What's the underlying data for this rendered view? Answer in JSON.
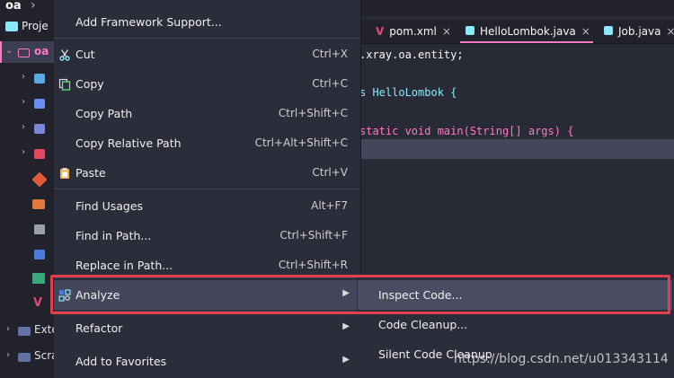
{
  "breadcrumb": {
    "label": "oa"
  },
  "project_panel": {
    "tab_label": "Proje",
    "root_label": "oa",
    "bottom_items": [
      {
        "label": "Exte"
      },
      {
        "label": "Scra"
      }
    ]
  },
  "editor": {
    "tabs": [
      {
        "label": "pom.xml",
        "icon": "maven-icon",
        "close": "×"
      },
      {
        "label": "HelloLombok.java",
        "icon": "class-icon",
        "close": "×"
      },
      {
        "label": "Job.java",
        "icon": "class-icon",
        "close": "×"
      }
    ],
    "code_lines": [
      ".xray.oa.entity;",
      "s HelloLombok {",
      "static void main(String[] args) {"
    ]
  },
  "context_menu": {
    "items": [
      {
        "label": "Add Framework Support...",
        "shortcut": "",
        "submenu": false,
        "icon": ""
      },
      {
        "label": "Cut",
        "shortcut": "Ctrl+X",
        "submenu": false,
        "icon": "scissors-icon"
      },
      {
        "label": "Copy",
        "shortcut": "Ctrl+C",
        "submenu": false,
        "icon": "copy-icon"
      },
      {
        "label": "Copy Path",
        "shortcut": "Ctrl+Shift+C",
        "submenu": false,
        "icon": ""
      },
      {
        "label": "Copy Relative Path",
        "shortcut": "Ctrl+Alt+Shift+C",
        "submenu": false,
        "icon": ""
      },
      {
        "label": "Paste",
        "shortcut": "Ctrl+V",
        "submenu": false,
        "icon": "clipboard-icon"
      },
      {
        "label": "Find Usages",
        "shortcut": "Alt+F7",
        "submenu": false,
        "icon": ""
      },
      {
        "label": "Find in Path...",
        "shortcut": "Ctrl+Shift+F",
        "submenu": false,
        "icon": ""
      },
      {
        "label": "Replace in Path...",
        "shortcut": "Ctrl+Shift+R",
        "submenu": false,
        "icon": ""
      },
      {
        "label": "Analyze",
        "shortcut": "",
        "submenu": true,
        "icon": "analyze-icon"
      },
      {
        "label": "Refactor",
        "shortcut": "",
        "submenu": true,
        "icon": ""
      },
      {
        "label": "Add to Favorites",
        "shortcut": "",
        "submenu": true,
        "icon": ""
      }
    ],
    "submenu_arrow": "▶"
  },
  "analyze_submenu": {
    "items": [
      {
        "label": "Inspect Code..."
      },
      {
        "label": "Code Cleanup..."
      },
      {
        "label": "Silent Code Cleanup"
      }
    ]
  },
  "watermark": "https://blog.csdn.net/u013343114",
  "colors": {
    "highlight_box": "#e0414d",
    "accent": "#ff79c6",
    "menu_bg": "#2b2d3a"
  }
}
